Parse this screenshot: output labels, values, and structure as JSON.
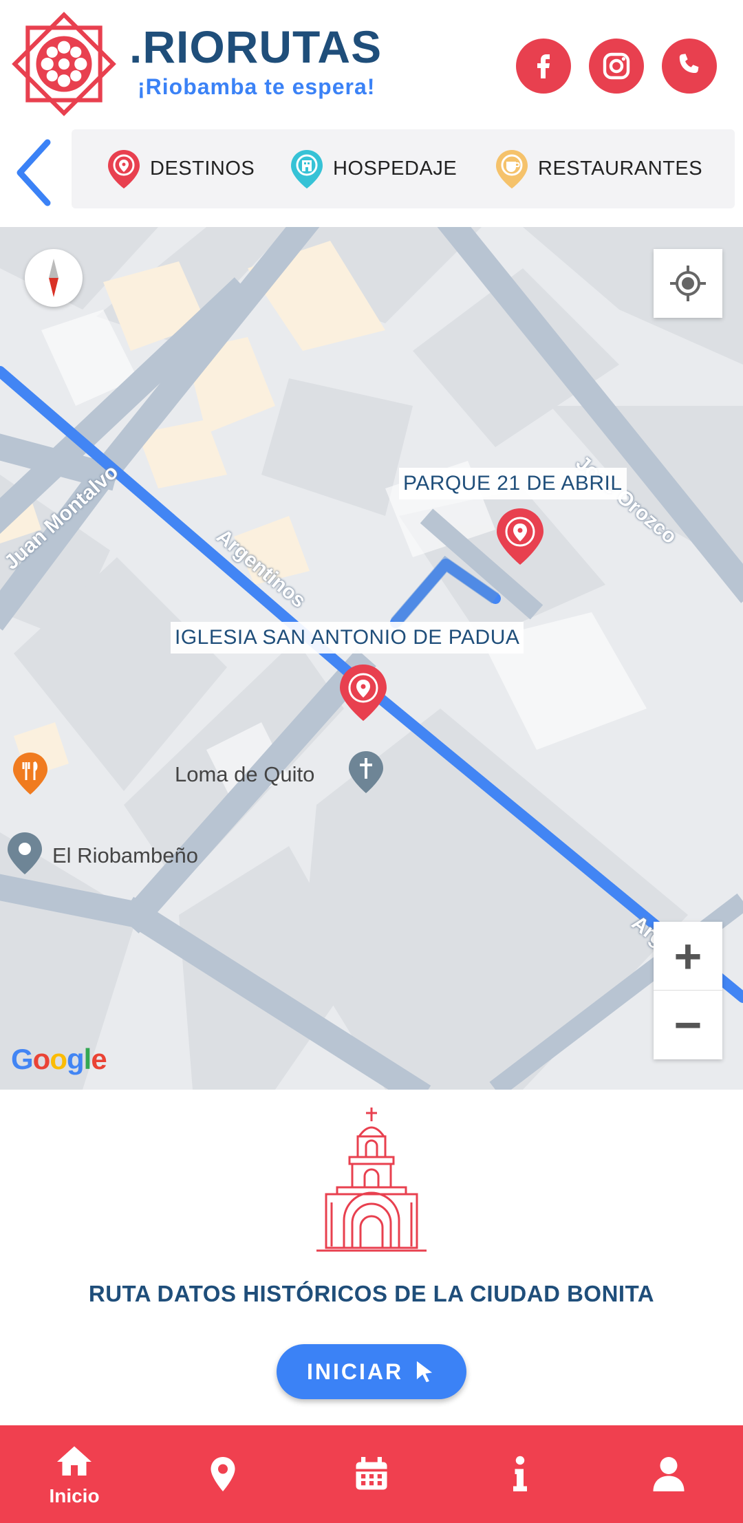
{
  "header": {
    "brand_title": ".RIORUTAS",
    "brand_subtitle": "¡Riobamba te espera!",
    "social": [
      {
        "name": "facebook-icon"
      },
      {
        "name": "instagram-icon"
      },
      {
        "name": "phone-icon"
      }
    ]
  },
  "categories": [
    {
      "label": "DESTINOS",
      "color": "#e8404f"
    },
    {
      "label": "HOSPEDAJE",
      "color": "#36c2d6"
    },
    {
      "label": "RESTAURANTES",
      "color": "#f5c26b"
    }
  ],
  "map": {
    "markers": [
      {
        "label": "PARQUE 21 DE ABRIL"
      },
      {
        "label": "IGLESIA SAN ANTONIO DE PADUA"
      }
    ],
    "pois": [
      {
        "label": "Loma de Quito",
        "icon": "church-icon"
      },
      {
        "label": "El Riobambeño",
        "icon": "place-pin-icon"
      }
    ],
    "streets": [
      "Juan Montalvo",
      "Argentinos",
      "Argentinos",
      "José Orozco"
    ],
    "attribution": "Google",
    "route_color": "#4285f4"
  },
  "route": {
    "title": "RUTA DATOS HISTÓRICOS DE LA CIUDAD BONITA",
    "start_label": "INICIAR"
  },
  "bottom_nav": {
    "items": [
      {
        "label": "Inicio",
        "icon": "home-icon",
        "active": true
      },
      {
        "label": "",
        "icon": "location-pin-icon"
      },
      {
        "label": "",
        "icon": "calendar-icon"
      },
      {
        "label": "",
        "icon": "info-icon"
      },
      {
        "label": "",
        "icon": "user-icon"
      }
    ]
  },
  "colors": {
    "brand_red": "#e8404f",
    "brand_blue": "#1f4e7a",
    "accent_blue": "#3b82f6"
  }
}
